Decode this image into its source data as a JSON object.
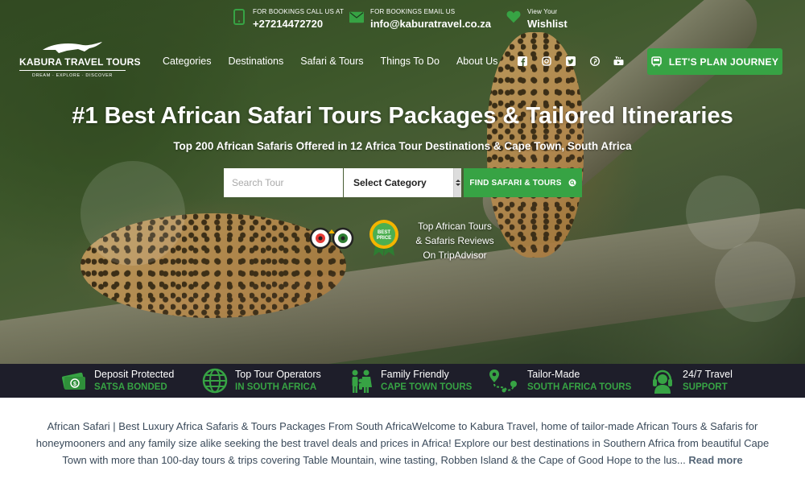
{
  "brand": {
    "name": "KABURA TRAVEL TOURS",
    "tagline": "DREAM · EXPLORE · DISCOVER"
  },
  "contacts": [
    {
      "icon": "phone-icon",
      "label": "FOR BOOKINGS CALL US AT",
      "value": "+27214472720"
    },
    {
      "icon": "envelope-icon",
      "label": "FOR BOOKINGS EMAIL US",
      "value": "info@kaburatravel.co.za"
    },
    {
      "icon": "heart-icon",
      "label": "View Your",
      "value": "Wishlist"
    }
  ],
  "nav": [
    "Categories",
    "Destinations",
    "Safari & Tours",
    "Things To Do",
    "About Us"
  ],
  "social": [
    "facebook-icon",
    "instagram-icon",
    "twitter-icon",
    "pinterest-icon",
    "youtube-icon"
  ],
  "plan_button": "LET'S PLAN JOURNEY",
  "hero": {
    "headline": "#1 Best African Safari Tours Packages & Tailored Itineraries",
    "subhead": "Top 200 African Safaris Offered in 12 Africa Tour Destinations & Cape Town, South Africa"
  },
  "search": {
    "placeholder": "Search Tour",
    "category_selected": "Select Category",
    "button": "FIND SAFARI & TOURS"
  },
  "tripadvisor": {
    "badge_text": "BEST PRICE",
    "line1": "Top African Tours",
    "line2": "& Safaris Reviews",
    "line3": "On TripAdvisor"
  },
  "features": [
    {
      "icon": "money-icon",
      "title": "Deposit Protected",
      "subtitle": "SATSA BONDED"
    },
    {
      "icon": "globe-icon",
      "title": "Top Tour Operators",
      "subtitle": "IN SOUTH AFRICA"
    },
    {
      "icon": "family-icon",
      "title": "Family Friendly",
      "subtitle": "CAPE TOWN TOURS"
    },
    {
      "icon": "route-icon",
      "title": "Tailor-Made",
      "subtitle": "SOUTH AFRICA TOURS"
    },
    {
      "icon": "headset-icon",
      "title": "24/7 Travel",
      "subtitle": "SUPPORT"
    }
  ],
  "intro": {
    "text": "African Safari | Best Luxury Africa Safaris & Tours Packages From South AfricaWelcome to Kabura Travel, home of tailor-made African Tours & Safaris for honeymooners and any family size alike seeking the best travel deals and prices in Africa! Explore our best destinations in Southern Africa from beautiful Cape Town with more than 100-day tours & trips covering Table Mountain, wine tasting, Robben Island & the Cape of Good Hope to the lus...",
    "read_more": "Read more"
  },
  "colors": {
    "accent": "#37a344",
    "feature_bar": "#1e1e2a",
    "intro_text": "#3a4a5a"
  }
}
